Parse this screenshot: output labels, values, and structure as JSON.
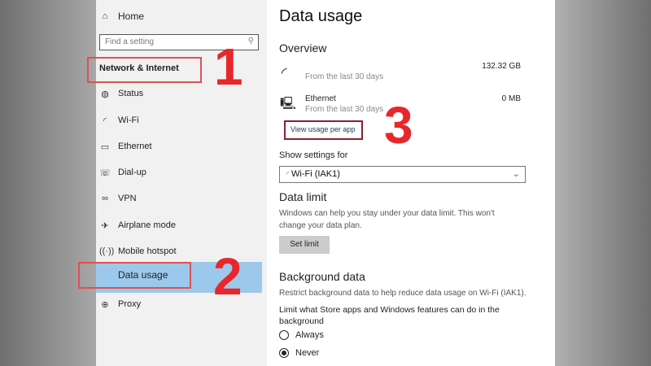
{
  "sidebar": {
    "home": "Home",
    "search_placeholder": "Find a setting",
    "section": "Network & Internet",
    "items": [
      {
        "label": "Status",
        "icon": "globe-icon"
      },
      {
        "label": "Wi-Fi",
        "icon": "wifi-icon"
      },
      {
        "label": "Ethernet",
        "icon": "ethernet-icon"
      },
      {
        "label": "Dial-up",
        "icon": "dialup-icon"
      },
      {
        "label": "VPN",
        "icon": "vpn-icon"
      },
      {
        "label": "Airplane mode",
        "icon": "airplane-icon"
      },
      {
        "label": "Mobile hotspot",
        "icon": "hotspot-icon"
      },
      {
        "label": "Data usage",
        "icon": "data-usage-icon"
      },
      {
        "label": "Proxy",
        "icon": "proxy-icon"
      }
    ]
  },
  "main": {
    "title": "Data usage",
    "overview": "Overview",
    "wifi": {
      "amount": "132.32 GB",
      "period": "From the last 30 days"
    },
    "ethernet": {
      "name": "Ethernet",
      "amount": "0 MB",
      "period": "From the last 30 days"
    },
    "view_usage": "View usage per app",
    "show_settings_for": "Show settings for",
    "network_select": "Wi-Fi (IAK1)",
    "data_limit": {
      "heading": "Data limit",
      "desc1": "Windows can help you stay under your data limit. This won't",
      "desc2": "change your data plan.",
      "button": "Set limit"
    },
    "background": {
      "heading": "Background data",
      "desc": "Restrict background data to help reduce data usage on Wi-Fi (IAK1).",
      "limit1": "Limit what Store apps and Windows features can do in the",
      "limit2": "background",
      "options": [
        "Always",
        "Never"
      ],
      "selected": "Never"
    }
  },
  "annotations": [
    "1",
    "2",
    "3"
  ],
  "colors": {
    "highlight": "#9cc8ec",
    "annotation": "#e8262b"
  }
}
